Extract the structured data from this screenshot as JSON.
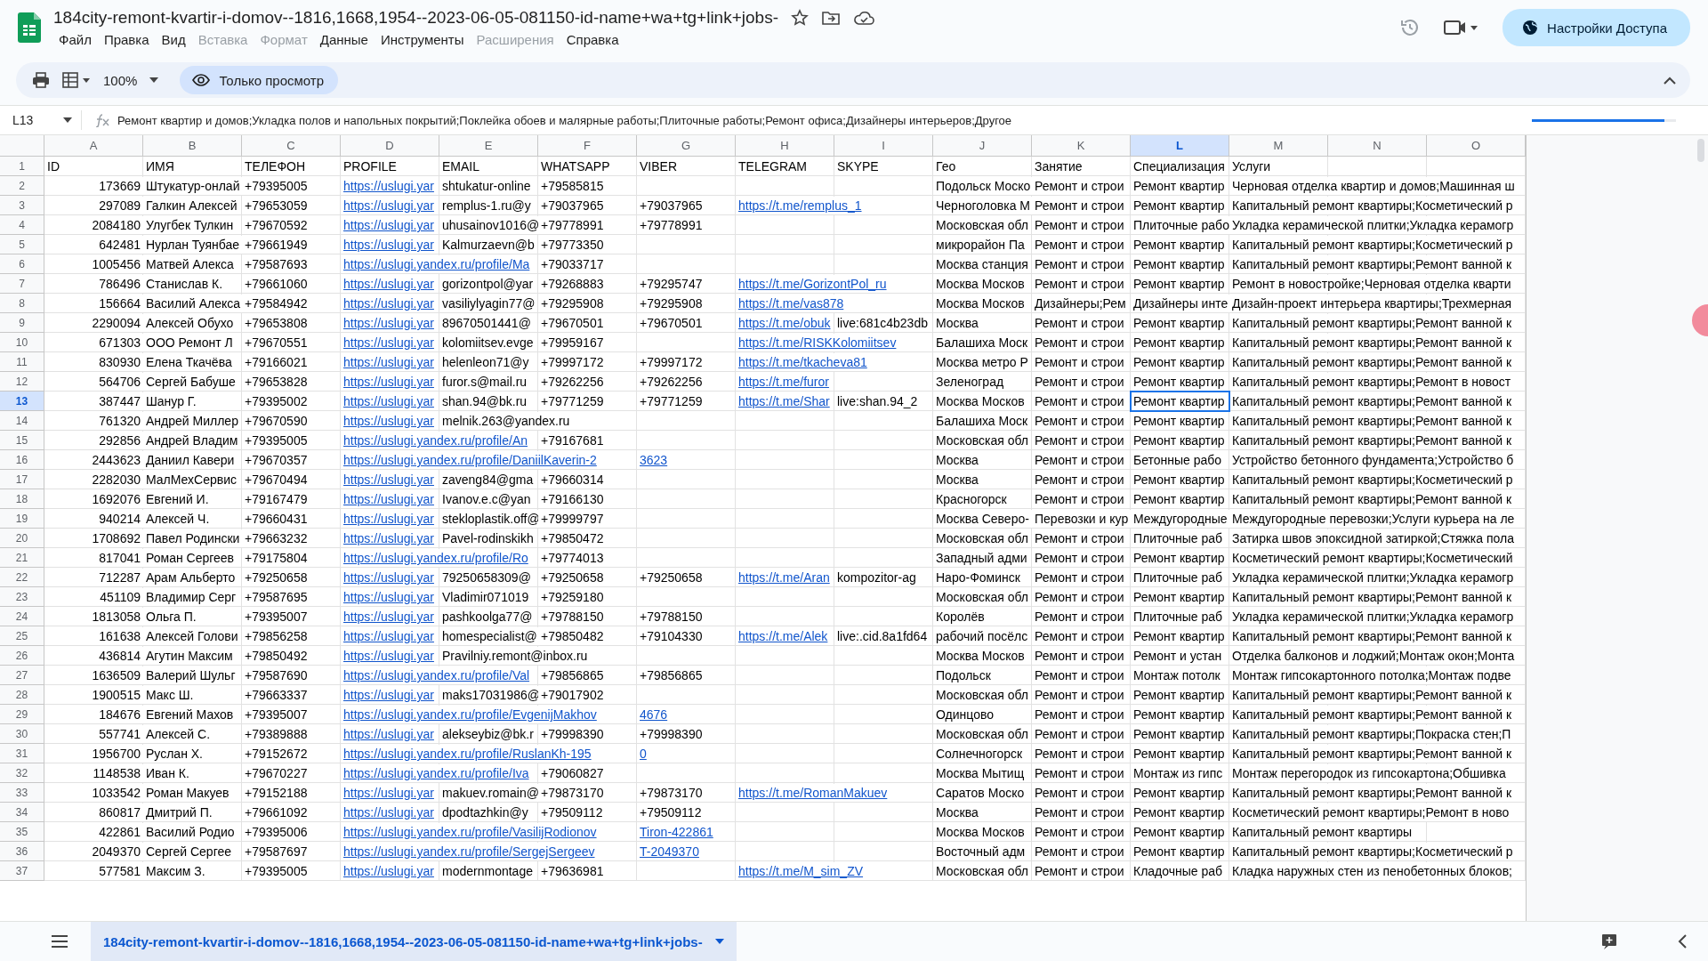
{
  "document": {
    "title": "184city-remont-kvartir-i-domov--1816,1668,1954--2023-06-05-081150-id-name+wa+tg+link+jobs-",
    "menu": [
      {
        "label": "Файл",
        "disabled": false
      },
      {
        "label": "Правка",
        "disabled": false
      },
      {
        "label": "Вид",
        "disabled": false
      },
      {
        "label": "Вставка",
        "disabled": true
      },
      {
        "label": "Формат",
        "disabled": true
      },
      {
        "label": "Данные",
        "disabled": false
      },
      {
        "label": "Инструменты",
        "disabled": false
      },
      {
        "label": "Расширения",
        "disabled": true
      },
      {
        "label": "Справка",
        "disabled": false
      }
    ],
    "share_button": "Настройки Доступа"
  },
  "toolbar": {
    "zoom": "100%",
    "mode": "Только просмотр"
  },
  "formula_bar": {
    "cell_ref": "L13",
    "content": "Ремонт квартир и домов;Укладка полов и напольных покрытий;Поклейка обоев и малярные работы;Плиточные работы;Ремонт офиса;Дизайнеры интерьеров;Другое",
    "loading": {
      "level": 0.92
    }
  },
  "columns": [
    {
      "letter": "A",
      "selected": false
    },
    {
      "letter": "B",
      "selected": false
    },
    {
      "letter": "C",
      "selected": false
    },
    {
      "letter": "D",
      "selected": false
    },
    {
      "letter": "E",
      "selected": false
    },
    {
      "letter": "F",
      "selected": false
    },
    {
      "letter": "G",
      "selected": false
    },
    {
      "letter": "H",
      "selected": false
    },
    {
      "letter": "I",
      "selected": false
    },
    {
      "letter": "J",
      "selected": false
    },
    {
      "letter": "K",
      "selected": false
    },
    {
      "letter": "L",
      "selected": true
    },
    {
      "letter": "M",
      "selected": false
    },
    {
      "letter": "N",
      "selected": false
    },
    {
      "letter": "O",
      "selected": false
    }
  ],
  "rows": [
    {
      "number": "1",
      "selected": false,
      "cells": {
        "A": "ID",
        "B": "ИМЯ",
        "C": "ТЕЛЕФОН",
        "D": "PROFILE",
        "E": "EMAIL",
        "F": "WHATSAPP",
        "G": "VIBER",
        "H": "TELEGRAM",
        "I": "SKYPE",
        "J": "Гео",
        "K": "Занятие",
        "L": "Специализация",
        "M": "Услуги"
      }
    },
    {
      "number": "2",
      "selected": false,
      "cells": {
        "A": "173669",
        "B": "Штукатур-онлай",
        "C": "+79395005",
        "D": {
          "kind": "link",
          "text": "https://uslugi.yar"
        },
        "E": "shtukatur-online",
        "F": "+79585815",
        "J": "Подольск Моско",
        "K": "Ремонт и строи",
        "L": "Ремонт квартир",
        "M": "Черновая отделка квартир и домов;Машинная ш"
      }
    },
    {
      "number": "3",
      "selected": false,
      "cells": {
        "A": "297089",
        "B": "Галкин Алексей",
        "C": "+79653059",
        "D": {
          "kind": "link",
          "text": "https://uslugi.yar"
        },
        "E": "remplus-1.ru@y",
        "F": "+79037965",
        "G": "+79037965",
        "H": {
          "kind": "link",
          "text": "https://t.me/remplus_1"
        },
        "J": "Черноголовка М",
        "K": "Ремонт и строи",
        "L": "Ремонт квартир",
        "M": "Капитальный ремонт квартиры;Косметический р"
      }
    },
    {
      "number": "4",
      "selected": false,
      "cells": {
        "A": "2084180",
        "B": "Улугбек Тулкин",
        "C": "+79670592",
        "D": {
          "kind": "link",
          "text": "https://uslugi.yar"
        },
        "E": "uhusainov1016@",
        "F": "+79778991",
        "G": "+79778991",
        "J": "Московская обл",
        "K": "Ремонт и строи",
        "L": "Плиточные рабо",
        "M": "Укладка керамической плитки;Укладка керамогр"
      }
    },
    {
      "number": "5",
      "selected": false,
      "cells": {
        "A": "642481",
        "B": "Нурлан Туянбае",
        "C": "+79661949",
        "D": {
          "kind": "link",
          "text": "https://uslugi.yar"
        },
        "E": "Kalmurzaevn@b",
        "F": "+79773350",
        "J": "микрорайон Па",
        "K": "Ремонт и строи",
        "L": "Ремонт квартир",
        "M": "Капитальный ремонт квартиры;Косметический р"
      }
    },
    {
      "number": "6",
      "selected": false,
      "cells": {
        "A": "1005456",
        "B": "Матвей Алекса",
        "C": "+79587693",
        "D": {
          "kind": "link",
          "text": "https://uslugi.yandex.ru/profile/Ma"
        },
        "F": "+79033717",
        "J": "Москва станция",
        "K": "Ремонт и строи",
        "L": "Ремонт квартир",
        "M": "Капитальный ремонт квартиры;Ремонт ванной к"
      }
    },
    {
      "number": "7",
      "selected": false,
      "cells": {
        "A": "786496",
        "B": "Станислав К.",
        "C": "+79661060",
        "D": {
          "kind": "link",
          "text": "https://uslugi.yar"
        },
        "E": "gorizontpol@yar",
        "F": "+79268883",
        "G": "+79295747",
        "H": {
          "kind": "link",
          "text": "https://t.me/GorizontPol_ru"
        },
        "J": "Москва Москов",
        "K": "Ремонт и строи",
        "L": "Ремонт квартир",
        "M": "Ремонт в новостройке;Черновая отделка кварти"
      }
    },
    {
      "number": "8",
      "selected": false,
      "cells": {
        "A": "156664",
        "B": "Василий Алекса",
        "C": "+79584942",
        "D": {
          "kind": "link",
          "text": "https://uslugi.yar"
        },
        "E": "vasiliylyagin77@",
        "F": "+79295908",
        "G": "+79295908",
        "H": {
          "kind": "link",
          "text": "https://t.me/vas878"
        },
        "J": "Москва Москов",
        "K": "Дизайнеры;Рем",
        "L": "Дизайнеры инте",
        "M": "Дизайн-проект интерьера квартиры;Трехмерная"
      }
    },
    {
      "number": "9",
      "selected": false,
      "cells": {
        "A": "2290094",
        "B": "Алексей Обухо",
        "C": "+79653808",
        "D": {
          "kind": "link",
          "text": "https://uslugi.yar"
        },
        "E": "89670501441@",
        "F": "+79670501",
        "G": "+79670501",
        "H": {
          "kind": "link",
          "text": "https://t.me/obuk"
        },
        "I": "live:681c4b23db",
        "J": "Москва",
        "K": "Ремонт и строи",
        "L": "Ремонт квартир",
        "M": "Капитальный ремонт квартиры;Ремонт ванной к"
      }
    },
    {
      "number": "10",
      "selected": false,
      "cells": {
        "A": "671303",
        "B": "ООО Ремонт Л",
        "C": "+79670551",
        "D": {
          "kind": "link",
          "text": "https://uslugi.yar"
        },
        "E": "kolomiitsev.evge",
        "F": "+79959167",
        "H": {
          "kind": "link",
          "text": "https://t.me/RISKKolomiitsev"
        },
        "J": "Балашиха Моск",
        "K": "Ремонт и строи",
        "L": "Ремонт квартир",
        "M": "Капитальный ремонт квартиры;Ремонт ванной к"
      }
    },
    {
      "number": "11",
      "selected": false,
      "cells": {
        "A": "830930",
        "B": "Елена Ткачёва",
        "C": "+79166021",
        "D": {
          "kind": "link",
          "text": "https://uslugi.yar"
        },
        "E": "helenleon71@y",
        "F": "+79997172",
        "G": "+79997172",
        "H": {
          "kind": "link",
          "text": "https://t.me/tkacheva81"
        },
        "J": "Москва метро Р",
        "K": "Ремонт и строи",
        "L": "Ремонт квартир",
        "M": "Капитальный ремонт квартиры;Ремонт ванной к"
      }
    },
    {
      "number": "12",
      "selected": false,
      "cells": {
        "A": "564706",
        "B": "Сергей Бабуше",
        "C": "+79653828",
        "D": {
          "kind": "link",
          "text": "https://uslugi.yar"
        },
        "E": "furor.s@mail.ru",
        "F": "+79262256",
        "G": "+79262256",
        "H": {
          "kind": "link",
          "text": "https://t.me/furor"
        },
        "J": "Зеленоград",
        "K": "Ремонт и строи",
        "L": "Ремонт квартир",
        "M": "Капитальный ремонт квартиры;Ремонт в новост"
      }
    },
    {
      "number": "13",
      "selected": true,
      "cells": {
        "A": "387447",
        "B": "Шанур Г.",
        "C": "+79395002",
        "D": {
          "kind": "link",
          "text": "https://uslugi.yar"
        },
        "E": "shan.94@bk.ru",
        "F": "+79771259",
        "G": "+79771259",
        "H": {
          "kind": "link",
          "text": "https://t.me/Shar"
        },
        "I": "live:shan.94_2",
        "J": "Москва Москов",
        "K": "Ремонт и строи",
        "L": "Ремонт квартир",
        "M": "Капитальный ремонт квартиры;Ремонт ванной к"
      }
    },
    {
      "number": "14",
      "selected": false,
      "cells": {
        "A": "761320",
        "B": "Андрей Миллер",
        "C": "+79670590",
        "D": {
          "kind": "link",
          "text": "https://uslugi.yar"
        },
        "E": "melnik.263@yandex.ru",
        "J": "Балашиха Моск",
        "K": "Ремонт и строи",
        "L": "Ремонт квартир",
        "M": "Капитальный ремонт квартиры;Ремонт ванной к"
      }
    },
    {
      "number": "15",
      "selected": false,
      "cells": {
        "A": "292856",
        "B": "Андрей Владим",
        "C": "+79395005",
        "D": {
          "kind": "link",
          "text": "https://uslugi.yandex.ru/profile/An"
        },
        "F": "+79167681",
        "J": "Московская обл",
        "K": "Ремонт и строи",
        "L": "Ремонт квартир",
        "M": "Капитальный ремонт квартиры;Ремонт ванной к"
      }
    },
    {
      "number": "16",
      "selected": false,
      "cells": {
        "A": "2443623",
        "B": "Даниил Кавери",
        "C": "+79670357",
        "D": {
          "kind": "link",
          "text": "https://uslugi.yandex.ru/profile/DaniilKaverin-2"
        },
        "G": {
          "kind": "link",
          "text": "3623"
        },
        "J": "Москва",
        "K": "Ремонт и строи",
        "L": "Бетонные рабо",
        "M": "Устройство бетонного фундамента;Устройство б"
      }
    },
    {
      "number": "17",
      "selected": false,
      "cells": {
        "A": "2282030",
        "B": "МалМехСервис",
        "C": "+79670494",
        "D": {
          "kind": "link",
          "text": "https://uslugi.yar"
        },
        "E": "zaveng84@gma",
        "F": "+79660314",
        "J": "Москва",
        "K": "Ремонт и строи",
        "L": "Ремонт квартир",
        "M": "Капитальный ремонт квартиры;Косметический р"
      }
    },
    {
      "number": "18",
      "selected": false,
      "cells": {
        "A": "1692076",
        "B": "Евгений И.",
        "C": "+79167479",
        "D": {
          "kind": "link",
          "text": "https://uslugi.yar"
        },
        "E": "Ivanov.e.c@yan",
        "F": "+79166130",
        "J": "Красногорск",
        "K": "Ремонт и строи",
        "L": "Ремонт квартир",
        "M": "Капитальный ремонт квартиры;Ремонт ванной к"
      }
    },
    {
      "number": "19",
      "selected": false,
      "cells": {
        "A": "940214",
        "B": "Алексей Ч.",
        "C": "+79660431",
        "D": {
          "kind": "link",
          "text": "https://uslugi.yar"
        },
        "E": "stekloplastik.off@",
        "F": "+79999797",
        "J": "Москва Северо-",
        "K": "Перевозки и кур",
        "L": "Междугородные",
        "M": "Междугородные перевозки;Услуги курьера на ле"
      }
    },
    {
      "number": "20",
      "selected": false,
      "cells": {
        "A": "1708692",
        "B": "Павел Родински",
        "C": "+79663232",
        "D": {
          "kind": "link",
          "text": "https://uslugi.yar"
        },
        "E": "Pavel-rodinskikh",
        "F": "+79850472",
        "J": "Московская обл",
        "K": "Ремонт и строи",
        "L": "Плиточные раб",
        "M": "Затирка швов эпоксидной затиркой;Стяжка пола"
      }
    },
    {
      "number": "21",
      "selected": false,
      "cells": {
        "A": "817041",
        "B": "Роман Сергеев",
        "C": "+79175804",
        "D": {
          "kind": "link",
          "text": "https://uslugi.yandex.ru/profile/Ro"
        },
        "F": "+79774013",
        "J": "Западный адми",
        "K": "Ремонт и строи",
        "L": "Ремонт квартир",
        "M": "Косметический ремонт квартиры;Косметический"
      }
    },
    {
      "number": "22",
      "selected": false,
      "cells": {
        "A": "712287",
        "B": "Арам Альберто",
        "C": "+79250658",
        "D": {
          "kind": "link",
          "text": "https://uslugi.yar"
        },
        "E": "79250658309@",
        "F": "+79250658",
        "G": "+79250658",
        "H": {
          "kind": "link",
          "text": "https://t.me/Aran"
        },
        "I": "kompozitor-ag",
        "J": "Наро-Фоминск",
        "K": "Ремонт и строи",
        "L": "Плиточные раб",
        "M": "Укладка керамической плитки;Укладка керамогр"
      }
    },
    {
      "number": "23",
      "selected": false,
      "cells": {
        "A": "451109",
        "B": "Владимир Серг",
        "C": "+79587695",
        "D": {
          "kind": "link",
          "text": "https://uslugi.yar"
        },
        "E": "Vladimir071019",
        "F": "+79259180",
        "J": "Московская обл",
        "K": "Ремонт и строи",
        "L": "Ремонт квартир",
        "M": "Капитальный ремонт квартиры;Ремонт ванной к"
      }
    },
    {
      "number": "24",
      "selected": false,
      "cells": {
        "A": "1813058",
        "B": "Ольга П.",
        "C": "+79395007",
        "D": {
          "kind": "link",
          "text": "https://uslugi.yar"
        },
        "E": "pashkoolga77@",
        "F": "+79788150",
        "G": "+79788150",
        "J": "Королёв",
        "K": "Ремонт и строи",
        "L": "Плиточные раб",
        "M": "Укладка керамической плитки;Укладка керамогр"
      }
    },
    {
      "number": "25",
      "selected": false,
      "cells": {
        "A": "161638",
        "B": "Алексей Голови",
        "C": "+79856258",
        "D": {
          "kind": "link",
          "text": "https://uslugi.yar"
        },
        "E": "homespecialist@",
        "F": "+79850482",
        "G": "+79104330",
        "H": {
          "kind": "link",
          "text": "https://t.me/Alek"
        },
        "I": "live:.cid.8a1fd64",
        "J": "рабочий посёлс",
        "K": "Ремонт и строи",
        "L": "Ремонт квартир",
        "M": "Капитальный ремонт квартиры;Ремонт ванной к"
      }
    },
    {
      "number": "26",
      "selected": false,
      "cells": {
        "A": "436814",
        "B": "Агутин Максим",
        "C": "+79850492",
        "D": {
          "kind": "link",
          "text": "https://uslugi.yar"
        },
        "E": "Pravilniy.remont@inbox.ru",
        "J": "Москва Москов",
        "K": "Ремонт и строи",
        "L": "Ремонт и устан",
        "M": "Отделка балконов и лоджий;Монтаж окон;Монта"
      }
    },
    {
      "number": "27",
      "selected": false,
      "cells": {
        "A": "1636509",
        "B": "Валерий Шульг",
        "C": "+79587690",
        "D": {
          "kind": "link",
          "text": "https://uslugi.yandex.ru/profile/Val"
        },
        "F": "+79856865",
        "G": "+79856865",
        "J": "Подольск",
        "K": "Ремонт и строи",
        "L": "Монтаж потолк",
        "M": "Монтаж гипсокартонного потолка;Монтаж подве"
      }
    },
    {
      "number": "28",
      "selected": false,
      "cells": {
        "A": "1900515",
        "B": "Макс Ш.",
        "C": "+79663337",
        "D": {
          "kind": "link",
          "text": "https://uslugi.yar"
        },
        "E": "maks17031986@",
        "F": "+79017902",
        "J": "Московская обл",
        "K": "Ремонт и строи",
        "L": "Ремонт квартир",
        "M": "Капитальный ремонт квартиры;Ремонт ванной к"
      }
    },
    {
      "number": "29",
      "selected": false,
      "cells": {
        "A": "184676",
        "B": "Евгений Махов",
        "C": "+79395007",
        "D": {
          "kind": "link",
          "text": "https://uslugi.yandex.ru/profile/EvgenijMakhov"
        },
        "G": {
          "kind": "link",
          "text": "4676"
        },
        "J": "Одинцово",
        "K": "Ремонт и строи",
        "L": "Ремонт квартир",
        "M": "Капитальный ремонт квартиры;Ремонт ванной к"
      }
    },
    {
      "number": "30",
      "selected": false,
      "cells": {
        "A": "557741",
        "B": "Алексей С.",
        "C": "+79389888",
        "D": {
          "kind": "link",
          "text": "https://uslugi.yar"
        },
        "E": "alekseybiz@bk.r",
        "F": "+79998390",
        "G": "+79998390",
        "J": "Московская обл",
        "K": "Ремонт и строи",
        "L": "Ремонт квартир",
        "M": "Капитальный ремонт квартиры;Покраска стен;П"
      }
    },
    {
      "number": "31",
      "selected": false,
      "cells": {
        "A": "1956700",
        "B": "Руслан Х.",
        "C": "+79152672",
        "D": {
          "kind": "link",
          "text": "https://uslugi.yandex.ru/profile/RuslanKh-195"
        },
        "G": {
          "kind": "link",
          "text": "0"
        },
        "J": "Солнечногорск",
        "K": "Ремонт и строи",
        "L": "Ремонт квартир",
        "M": "Капитальный ремонт квартиры;Ремонт ванной к"
      }
    },
    {
      "number": "32",
      "selected": false,
      "cells": {
        "A": "1148538",
        "B": "Иван К.",
        "C": "+79670227",
        "D": {
          "kind": "link",
          "text": "https://uslugi.yandex.ru/profile/Iva"
        },
        "F": "+79060827",
        "J": "Москва Мытищ",
        "K": "Ремонт и строи",
        "L": "Монтаж из гипс",
        "M": "Монтаж перегородок из гипсокартона;Обшивка"
      }
    },
    {
      "number": "33",
      "selected": false,
      "cells": {
        "A": "1033542",
        "B": "Роман Макуев",
        "C": "+79152188",
        "D": {
          "kind": "link",
          "text": "https://uslugi.yar"
        },
        "E": "makuev.romain@",
        "F": "+79873170",
        "G": "+79873170",
        "H": {
          "kind": "link",
          "text": "https://t.me/RomanMakuev"
        },
        "J": "Саратов Моско",
        "K": "Ремонт и строи",
        "L": "Ремонт квартир",
        "M": "Капитальный ремонт квартиры;Ремонт ванной к"
      }
    },
    {
      "number": "34",
      "selected": false,
      "cells": {
        "A": "860817",
        "B": "Дмитрий П.",
        "C": "+79661092",
        "D": {
          "kind": "link",
          "text": "https://uslugi.yar"
        },
        "E": "dpodtazhkin@y",
        "F": "+79509112",
        "G": "+79509112",
        "J": "Москва",
        "K": "Ремонт и строи",
        "L": "Ремонт квартир",
        "M": "Косметический ремонт квартиры;Ремонт в ново"
      }
    },
    {
      "number": "35",
      "selected": false,
      "cells": {
        "A": "422861",
        "B": "Василий Родио",
        "C": "+79395006",
        "D": {
          "kind": "link",
          "text": "https://uslugi.yandex.ru/profile/VasilijRodionov"
        },
        "G": {
          "kind": "link",
          "text": "Tiron-422861"
        },
        "J": "Москва Москов",
        "K": "Ремонт и строи",
        "L": "Ремонт квартир",
        "M": "Капитальный ремонт квартиры"
      }
    },
    {
      "number": "36",
      "selected": false,
      "cells": {
        "A": "2049370",
        "B": "Сергей Сергее",
        "C": "+79587697",
        "D": {
          "kind": "link",
          "text": "https://uslugi.yandex.ru/profile/SergejSergeev"
        },
        "G": {
          "kind": "link",
          "text": "T-2049370"
        },
        "J": "Восточный адм",
        "K": "Ремонт и строи",
        "L": "Ремонт квартир",
        "M": "Капитальный ремонт квартиры;Косметический р"
      }
    },
    {
      "number": "37",
      "selected": false,
      "cells": {
        "A": "577581",
        "B": "Максим З.",
        "C": "+79395005",
        "D": {
          "kind": "link",
          "text": "https://uslugi.yar"
        },
        "E": "modernmontage",
        "F": "+79636981",
        "H": {
          "kind": "link",
          "text": "https://t.me/M_sim_ZV"
        },
        "J": "Московская обл",
        "K": "Ремонт и строи",
        "L": "Кладочные раб",
        "M": "Кладка наружных стен из пенобетонных блоков;"
      }
    }
  ],
  "sheet_tabs": [
    {
      "label": "184city-remont-kvartir-i-domov--1816,1668,1954--2023-06-05-081150-id-name+wa+tg+link+jobs-",
      "selected": true
    }
  ]
}
